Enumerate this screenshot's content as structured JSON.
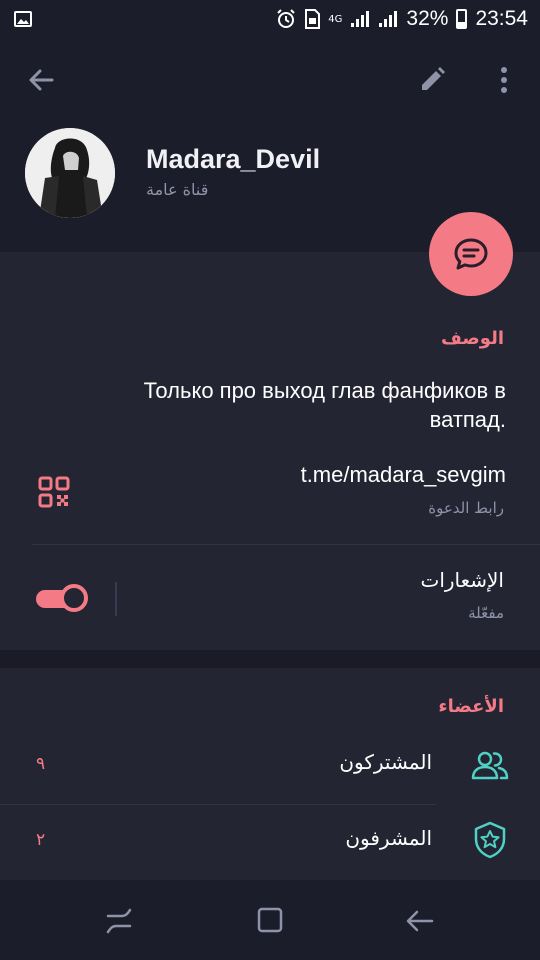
{
  "status_bar": {
    "network": "4G",
    "battery_percent": "32%",
    "time": "23:54"
  },
  "header": {
    "channel_name": "Madara_Devil",
    "channel_type": "قناة عامة"
  },
  "info": {
    "description_title": "الوصف",
    "description_text": "Только про выход глав фанфиков в ватпад.",
    "invite_link": "t.me/madara_sevgim",
    "invite_link_label": "رابط الدعوة",
    "notifications_title": "الإشعارات",
    "notifications_status": "مفعّلة",
    "notifications_enabled": true
  },
  "members": {
    "title": "الأعضاء",
    "rows": [
      {
        "label": "المشتركون",
        "count": "٩",
        "icon": "people-icon"
      },
      {
        "label": "المشرفون",
        "count": "٢",
        "icon": "admin-shield-icon"
      }
    ]
  },
  "colors": {
    "accent": "#f47a86",
    "teal": "#4fd1c5",
    "header_bg": "#1c1d2b",
    "section_bg": "#242533"
  }
}
